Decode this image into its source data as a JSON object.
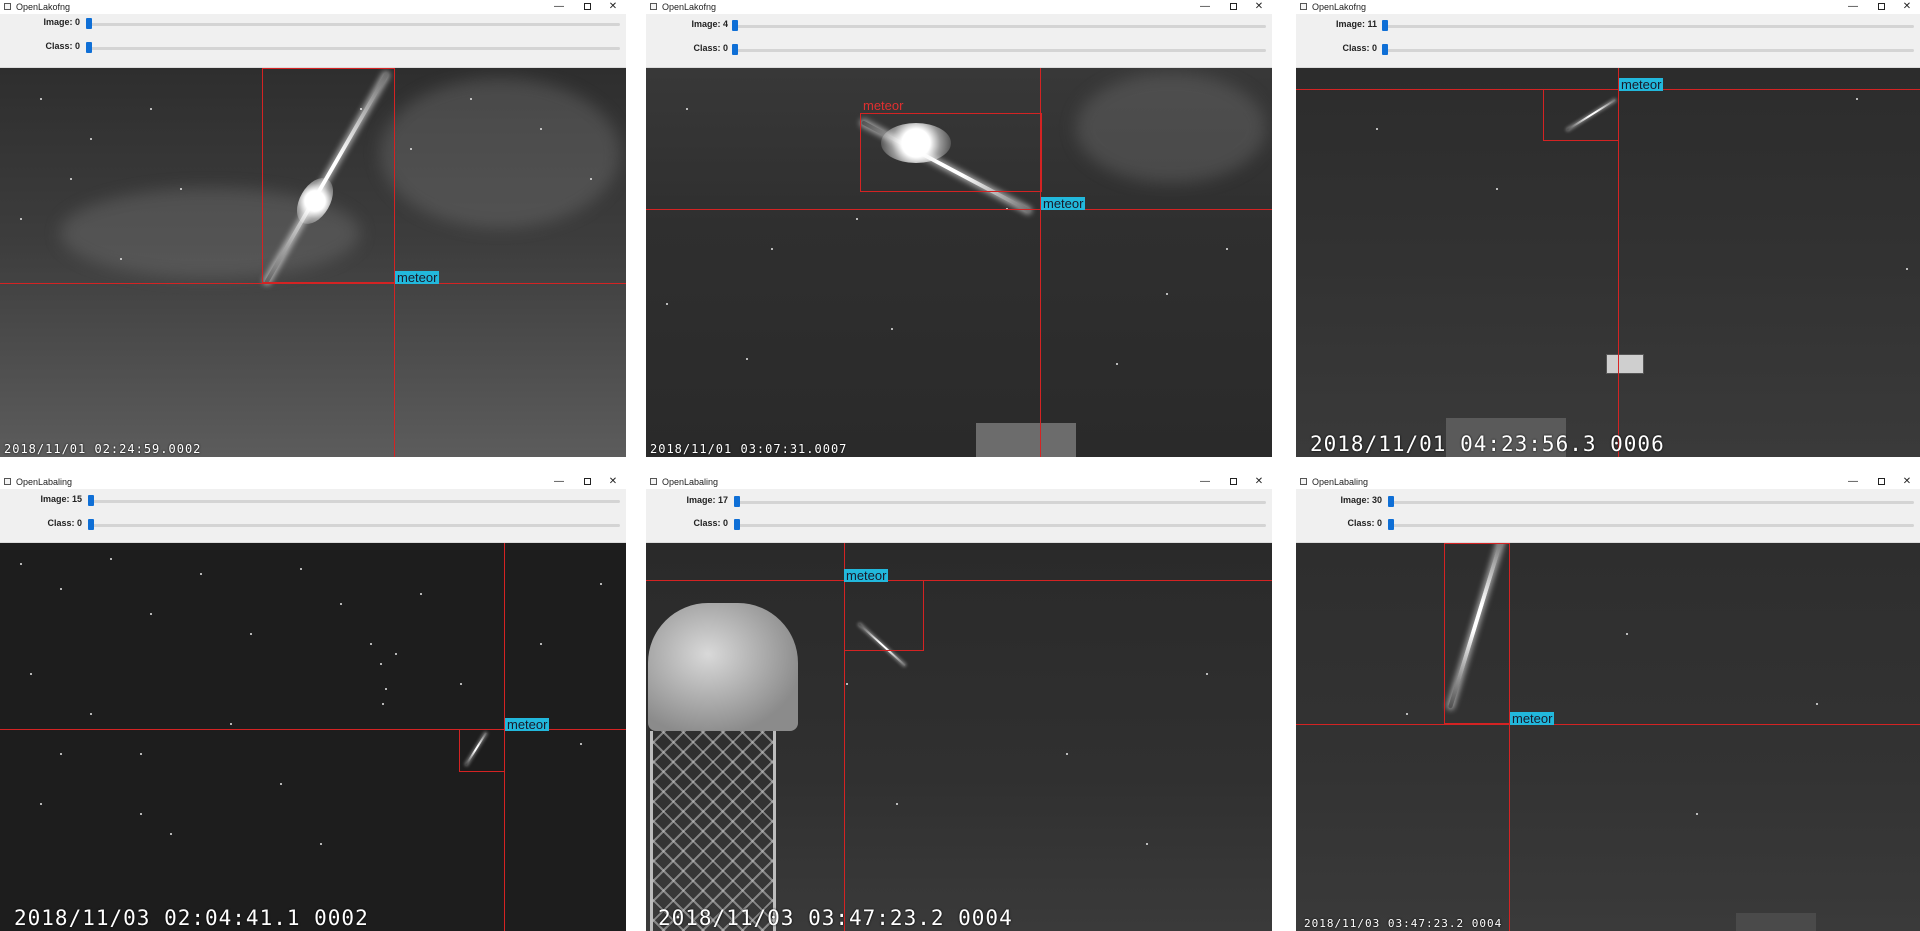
{
  "windows": [
    {
      "title": "OpenLakofng",
      "image_label": "Image: 0",
      "class_label": "Class: 0",
      "image_level": 0.0,
      "class_level": 0.0,
      "timestamp": "2018/11/01 02:24:59.0002",
      "tags": [
        {
          "text": "meteor",
          "style": "cyan"
        }
      ]
    },
    {
      "title": "OpenLakofng",
      "image_label": "Image: 4",
      "class_label": "Class: 0",
      "image_level": 0.0,
      "class_level": 0.0,
      "timestamp": "2018/11/01 03:07:31.0007",
      "tags": [
        {
          "text": "meteor",
          "style": "red"
        },
        {
          "text": "meteor",
          "style": "cyan"
        }
      ]
    },
    {
      "title": "OpenLakofng",
      "image_label": "Image: 11",
      "class_label": "Class: 0",
      "image_level": 0.0,
      "class_level": 0.0,
      "timestamp": "2018/11/01 04:23:56.3 0006",
      "tags": [
        {
          "text": "meteor",
          "style": "cyan"
        }
      ]
    },
    {
      "title": "OpenLabaling",
      "image_label": "Image: 15",
      "class_label": "Class: 0",
      "image_level": 0.0,
      "class_level": 0.0,
      "timestamp": "2018/11/03 02:04:41.1 0002",
      "tags": [
        {
          "text": "meteor",
          "style": "cyan"
        }
      ]
    },
    {
      "title": "OpenLabaling",
      "image_label": "Image: 17",
      "class_label": "Class: 0",
      "image_level": 0.0,
      "class_level": 0.0,
      "timestamp": "2018/11/03 03:47:23.2 0004",
      "tags": [
        {
          "text": "meteor",
          "style": "cyan"
        }
      ]
    },
    {
      "title": "OpenLabaling",
      "image_label": "Image: 30",
      "class_label": "Class: 0",
      "image_level": 0.0,
      "class_level": 0.0,
      "timestamp": "2018/11/03 03:47:23.2 0004",
      "tags": [
        {
          "text": "meteor",
          "style": "cyan"
        }
      ]
    }
  ],
  "controls": {
    "minimize": "—",
    "close": "✕"
  },
  "icons": {
    "app": "window-app-icon",
    "minimize": "minimize-icon",
    "maximize": "maximize-icon",
    "close": "close-icon"
  },
  "colors": {
    "bbox": "#d42323",
    "tag": "#22b8dc",
    "slider": "#0f6fd6"
  }
}
